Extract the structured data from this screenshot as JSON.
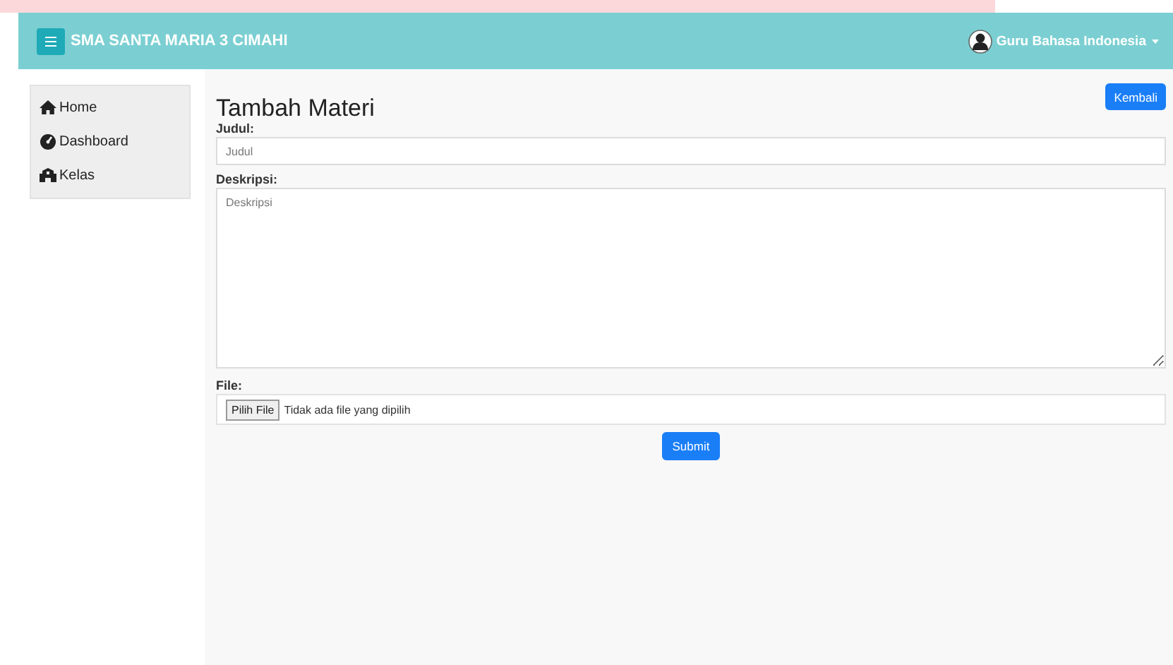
{
  "navbar": {
    "brand": "SMA SANTA MARIA 3 CIMAHI",
    "user": "Guru Bahasa Indonesia"
  },
  "sidebar": {
    "items": [
      {
        "label": "Home"
      },
      {
        "label": "Dashboard"
      },
      {
        "label": "Kelas"
      }
    ]
  },
  "page": {
    "title": "Tambah Materi",
    "back_button": "Kembali"
  },
  "form": {
    "fields": [
      {
        "kind": "text",
        "label": "Judul:",
        "placeholder": "Judul"
      },
      {
        "kind": "textarea",
        "label": "Deskripsi:",
        "placeholder": "Deskripsi"
      },
      {
        "kind": "file",
        "label": "File:",
        "button": "Pilih File",
        "status": "Tidak ada file yang dipilih"
      }
    ],
    "submit": "Submit"
  }
}
